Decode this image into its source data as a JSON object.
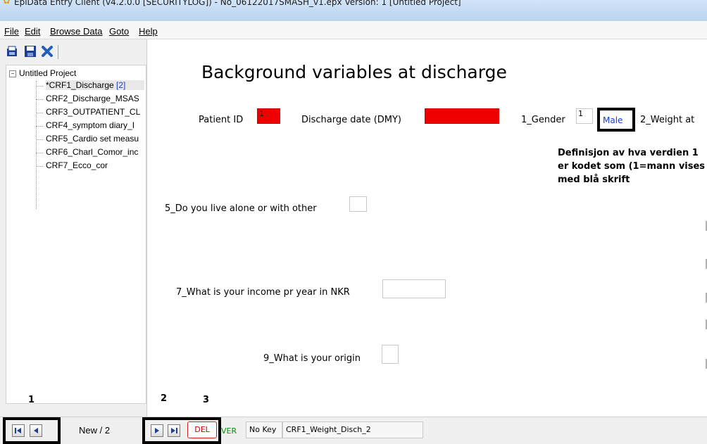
{
  "window": {
    "title": "EpiData Entry Client (v4.2.0.0 [SECURITYLOG]) - No_06122017SMASH_v1.epx Version: 1 [Untitled Project]"
  },
  "menu": {
    "file": "File",
    "edit": "Edit",
    "browse": "Browse Data",
    "goto": "Goto",
    "help": "Help"
  },
  "tree": {
    "root": "Untitled Project",
    "selected_badge": "[2]",
    "items": [
      "*CRF1_Discharge",
      "CRF2_Discharge_MSAS",
      "CRF3_OUTPATIENT_CL",
      "CRF4_symptom diary_I",
      "CRF5_Cardio set measu",
      "CRF6_Charl_Comor_inc",
      "CRF7_Ecco_cor"
    ]
  },
  "form": {
    "title": "Background variables at discharge",
    "patient_id_label": "Patient ID",
    "patient_id_value": "1",
    "discharge_date_label": "Discharge date (DMY)",
    "discharge_date_value": "",
    "gender_label": "1_Gender",
    "gender_value": "1",
    "gender_value_label": "Male",
    "weight_label": "2_Weight at",
    "live_alone_label": "5_Do you live alone or with other",
    "income_label": "7_What is your income pr year in NKR",
    "origin_label": "9_What is your origin"
  },
  "annotation": {
    "text": "Definisjon av hva verdien 1 er kodet som (1=mann vises med blå skrift"
  },
  "callouts": {
    "one": "1",
    "two": "2",
    "three": "3"
  },
  "statusbar": {
    "record_counter": "New / 2",
    "delete_label": "DEL",
    "verify_label": "VER",
    "key_label": "No Key",
    "current_field": "CRF1_Weight_Disch_2"
  },
  "colors": {
    "required_field": "#ee0000",
    "value_label": "#1a3ccf",
    "verify": "#0a8a0a",
    "delete": "#d00000"
  }
}
